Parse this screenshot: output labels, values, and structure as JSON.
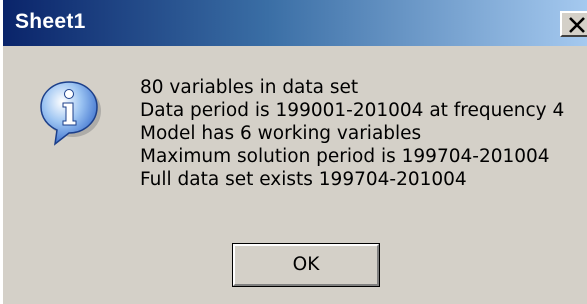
{
  "window": {
    "title": "Sheet1",
    "close_label": "Close"
  },
  "dialog": {
    "icon": "information-icon",
    "messages": [
      "80 variables in data set",
      "Data period is 199001-201004 at frequency 4",
      "Model has 6 working variables",
      "Maximum solution period is 199704-201004",
      "Full data set exists 199704-201004"
    ],
    "ok_label": "OK"
  },
  "colors": {
    "titlebar_start": "#0a246a",
    "titlebar_end": "#a6caf0",
    "dialog_background": "#d4d0c8",
    "info_icon_fill": "#3f7fe0"
  }
}
